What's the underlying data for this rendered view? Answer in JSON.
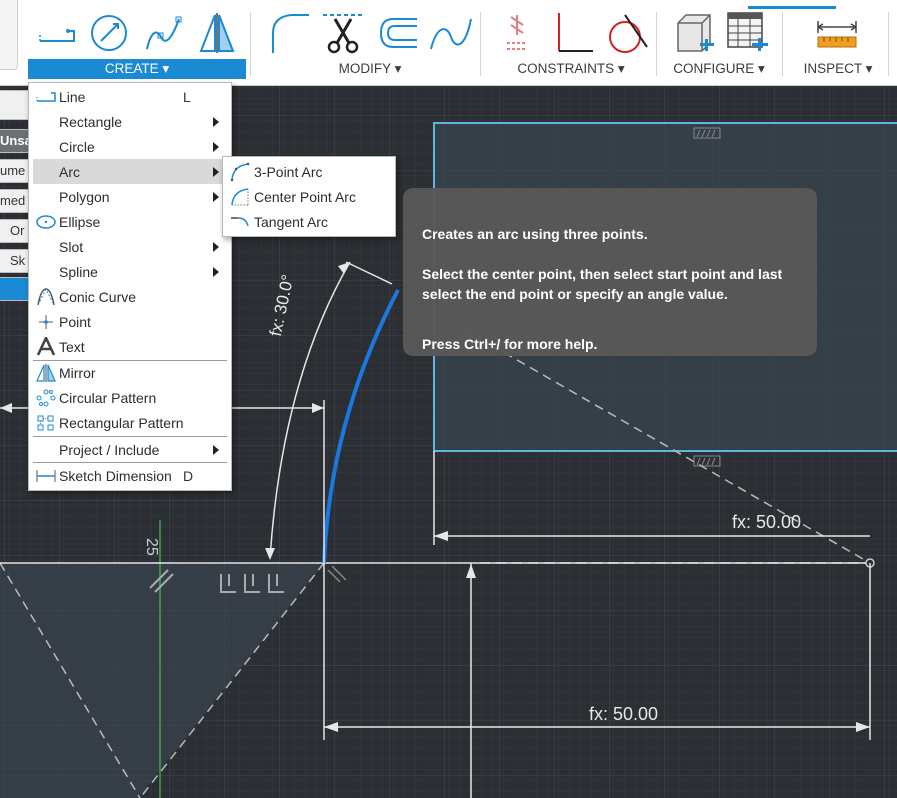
{
  "toolbar": {
    "groups": {
      "create": {
        "label": "CREATE ▾"
      },
      "modify": {
        "label": "MODIFY ▾"
      },
      "constraints": {
        "label": "CONSTRAINTS ▾"
      },
      "configure": {
        "label": "CONFIGURE ▾"
      },
      "inspect": {
        "label": "INSPECT ▾"
      }
    },
    "icons": {
      "create": [
        "line-icon",
        "circle-icon",
        "spline-icon",
        "mirror-icon"
      ],
      "modify": [
        "fillet-icon",
        "trim-icon",
        "offset-icon",
        "fit-spline-icon"
      ],
      "constraints": [
        "coincident-constraint-icon",
        "horizontal-vertical-icon",
        "tangent-icon"
      ],
      "configure": [
        "component-configure-icon",
        "table-configure-icon"
      ],
      "inspect": [
        "measure-icon"
      ]
    }
  },
  "browser_stubs": [
    "",
    "Unsa",
    "ume",
    "med",
    "Or",
    "Sk",
    ""
  ],
  "create_menu": {
    "items": [
      {
        "label": "Line",
        "shortcut": "L",
        "icon": "line-icon",
        "submenu": false
      },
      {
        "label": "Rectangle",
        "shortcut": "",
        "icon": "",
        "submenu": true
      },
      {
        "label": "Circle",
        "shortcut": "",
        "icon": "",
        "submenu": true
      },
      {
        "label": "Arc",
        "shortcut": "",
        "icon": "",
        "submenu": true,
        "highlighted": true
      },
      {
        "label": "Polygon",
        "shortcut": "",
        "icon": "",
        "submenu": true
      },
      {
        "label": "Ellipse",
        "shortcut": "",
        "icon": "ellipse-icon",
        "submenu": false
      },
      {
        "label": "Slot",
        "shortcut": "",
        "icon": "",
        "submenu": true
      },
      {
        "label": "Spline",
        "shortcut": "",
        "icon": "",
        "submenu": true
      },
      {
        "label": "Conic Curve",
        "shortcut": "",
        "icon": "conic-curve-icon",
        "submenu": false
      },
      {
        "label": "Point",
        "shortcut": "",
        "icon": "point-icon",
        "submenu": false
      },
      {
        "label": "Text",
        "shortcut": "",
        "icon": "text-icon",
        "submenu": false
      },
      {
        "label": "Mirror",
        "shortcut": "",
        "icon": "mirror-icon",
        "submenu": false
      },
      {
        "label": "Circular Pattern",
        "shortcut": "",
        "icon": "circular-pattern-icon",
        "submenu": false
      },
      {
        "label": "Rectangular Pattern",
        "shortcut": "",
        "icon": "rectangular-pattern-icon",
        "submenu": false
      },
      {
        "label": "Project / Include",
        "shortcut": "",
        "icon": "",
        "submenu": true
      },
      {
        "label": "Sketch Dimension",
        "shortcut": "D",
        "icon": "sketch-dimension-icon",
        "submenu": false
      }
    ]
  },
  "arc_submenu": {
    "items": [
      {
        "label": "3-Point Arc",
        "icon": "three-point-arc-icon"
      },
      {
        "label": "Center Point Arc",
        "icon": "center-point-arc-icon"
      },
      {
        "label": "Tangent Arc",
        "icon": "tangent-arc-icon"
      }
    ]
  },
  "tooltip": {
    "line1": "Creates an arc using three points.",
    "line2": "Select the center point, then select start point and last select the end point or specify an angle value.",
    "line3": "Press Ctrl+/ for more help."
  },
  "canvas": {
    "dimensions": {
      "angle": "fx: 30.0°",
      "horizontal_top": "fx: 50.00",
      "horizontal_bottom": "fx: 50.00",
      "vertical_partial": "25"
    },
    "colors": {
      "background": "#2b2e33",
      "grid_minor": "#363a40",
      "grid_major": "#444950",
      "sketch_line": "#e6e6e6",
      "selected_arc": "#1a78e0",
      "profile_fill": "#3a4550",
      "profile_outline": "#5db7e0",
      "axis_green": "#3fa34d"
    }
  }
}
